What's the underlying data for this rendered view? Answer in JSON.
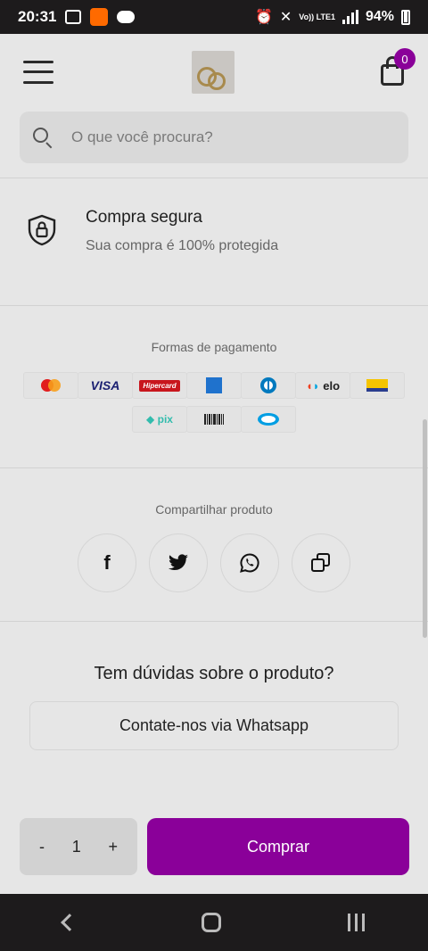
{
  "status_bar": {
    "time": "20:31",
    "network": "Vo)) LTE1",
    "battery": "94%"
  },
  "header": {
    "cart_count": "0"
  },
  "search": {
    "placeholder": "O que você procura?"
  },
  "secure": {
    "title": "Compra segura",
    "subtitle": "Sua compra é 100% protegida"
  },
  "payments": {
    "title": "Formas de pagamento",
    "row1": [
      "Mastercard",
      "VISA",
      "Hipercard",
      "American Express",
      "Diners Club",
      "elo",
      "Banescard"
    ],
    "row2": [
      "Pix",
      "Boleto",
      "Mercado Pago"
    ]
  },
  "share": {
    "title": "Compartilhar produto",
    "buttons": [
      "f",
      "Twitter",
      "WhatsApp",
      "Copy"
    ]
  },
  "faq": {
    "title": "Tem dúvidas sobre o produto?",
    "whatsapp_label": "Contate-nos via Whatsapp"
  },
  "purchase": {
    "minus": "-",
    "quantity": "1",
    "plus": "+",
    "buy_label": "Comprar",
    "accent": "#8a0099"
  }
}
